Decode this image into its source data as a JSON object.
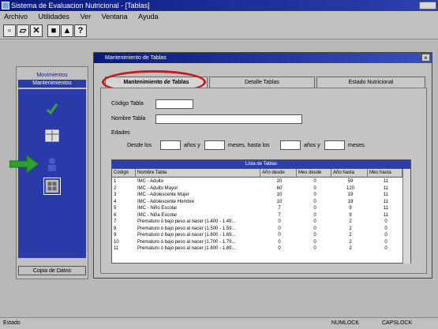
{
  "window": {
    "title": "Sistema de Evaluacion Nutricional - [Tablas]"
  },
  "menu": [
    "Archivo",
    "Utilidades",
    "Ver",
    "Ventana",
    "Ayuda"
  ],
  "toolbar": {
    "icons": [
      "new-icon",
      "open-icon",
      "delete-icon",
      "save-icon",
      "print-icon",
      "info-icon"
    ]
  },
  "sidebar": {
    "tab_top": "Movimientos",
    "tab_selected": "Mantenimientos",
    "footer": "Copia de Datos"
  },
  "dialog": {
    "title": "Mantenimiento de Tablas",
    "tabs": [
      "Mantenimiento de Tablas",
      "Detalle Tablas",
      "Estado Nutricional"
    ],
    "labels": {
      "codigo": "Código Tabla",
      "nombre": "Nombre Tabla",
      "edades": "Edades",
      "desde": "Desde los",
      "anos_y": "años y",
      "meses_hasta": "meses, hasta los",
      "anos_y2": "años y",
      "meses": "meses."
    },
    "grid": {
      "header": "Lista de Tablas",
      "columns": [
        "Código",
        "Nombre Tabla",
        "Año desde",
        "Mes desde",
        "Año hasta",
        "Mes hasta"
      ],
      "rows": [
        [
          "1",
          "IMC - Adulto",
          "20",
          "0",
          "59",
          "11"
        ],
        [
          "2",
          "IMC - Adulto Mayor",
          "60",
          "0",
          "120",
          "11"
        ],
        [
          "3",
          "IMC - Adolescente Mujer",
          "10",
          "0",
          "19",
          "11"
        ],
        [
          "4",
          "IMC - Adolescente Hombre",
          "10",
          "0",
          "19",
          "11"
        ],
        [
          "5",
          "IMC - Niño Escolar",
          "7",
          "0",
          "9",
          "11"
        ],
        [
          "6",
          "IMC - Niña Escolar",
          "7",
          "0",
          "9",
          "11"
        ],
        [
          "7",
          "Prematuro ó bajo peso al nacer (1.400 - 1.49...",
          "0",
          "0",
          "2",
          "0"
        ],
        [
          "8",
          "Prematuro ó bajo peso al nacer (1.500 - 1.59...",
          "0",
          "0",
          "2",
          "0"
        ],
        [
          "9",
          "Prematuro ó bajo peso al nacer (1.600 - 1.69...",
          "0",
          "0",
          "2",
          "0"
        ],
        [
          "10",
          "Prematuro ó bajo peso al nacer (1.700 - 1.79...",
          "0",
          "0",
          "2",
          "0"
        ],
        [
          "11",
          "Prematuro ó bajo peso al nacer (1.800 - 1.89...",
          "0",
          "0",
          "2",
          "0"
        ]
      ]
    }
  },
  "statusbar": {
    "left": "Estado",
    "mid": "NUMLOCK",
    "right": "CAPSLOCK"
  },
  "colors": {
    "title": "#0a1a7a",
    "panel": "#2a3aa8",
    "highlight": "#c41a1a",
    "arrow": "#2fa02f"
  }
}
